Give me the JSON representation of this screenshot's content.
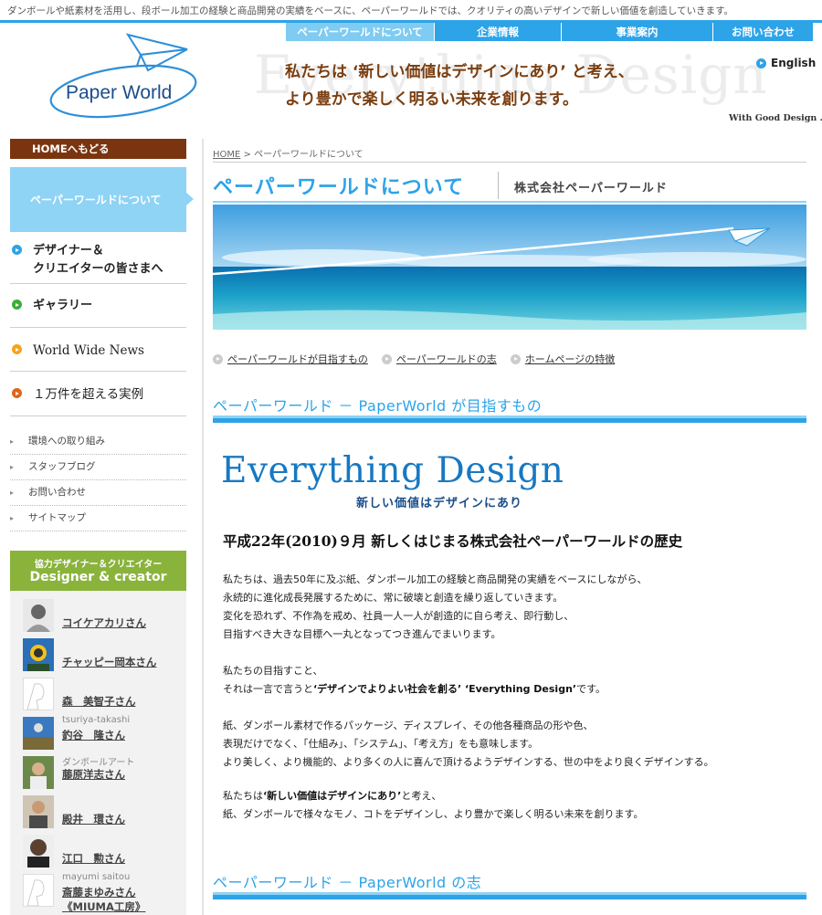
{
  "header": {
    "tagline": "ダンボールや紙素材を活用し、段ボール加工の経験と商品開発の実績をベースに、ペーパーワールドでは、クオリティの高いデザインで新しい価値を創造していきます。",
    "logo_text": "Paper World",
    "nav": [
      {
        "label": "ペーパーワールドについて",
        "active": true
      },
      {
        "label": "企業情報",
        "active": false
      },
      {
        "label": "事業案内",
        "active": false
      },
      {
        "label": "お問い合わせ",
        "active": false
      }
    ],
    "english_label": "English",
    "hero_bg_text": "Everything Design",
    "hero_line1": "私たちは ‘新しい価値はデザインにあり’ と考え、",
    "hero_line2": "より豊かで楽しく明るい未来を創ります。",
    "hero_small": "With Good Design ..."
  },
  "sidebar": {
    "home": "HOMEへもどる",
    "current": "ペーパーワールドについて",
    "items": [
      {
        "label": "デザイナー＆\nクリエイターの皆さまへ",
        "icon": "blue-arrow-icon"
      },
      {
        "label": "ギャラリー",
        "icon": "green-arrow-icon"
      },
      {
        "label": "World Wide News",
        "icon": "orange-arrow-icon"
      },
      {
        "label": "１万件を超える実例",
        "icon": "red-arrow-icon"
      }
    ],
    "sub_items": [
      "環境への取り組み",
      "スタッフブログ",
      "お問い合わせ",
      "サイトマップ"
    ],
    "designer_head_small": "協力デザイナー＆クリエイター",
    "designer_head_big": "Designer & creator",
    "designers": [
      {
        "sub": "",
        "name": "コイケアカリさん"
      },
      {
        "sub": "",
        "name": "チャッピー岡本さん"
      },
      {
        "sub": "",
        "name": "森　美智子さん"
      },
      {
        "sub": "tsuriya-takashi",
        "name": "釣谷　隆さん"
      },
      {
        "sub": "ダンボールアート",
        "name": "藤原洋志さん"
      },
      {
        "sub": "",
        "name": "殿井　環さん"
      },
      {
        "sub": "",
        "name": "江口　勲さん"
      },
      {
        "sub": "mayumi saitou",
        "name": "斎藤まゆみさん",
        "name2": "《MIUMA工房》"
      }
    ]
  },
  "main": {
    "breadcrumb_home": "HOME",
    "breadcrumb_rest": " > ペーパーワールドについて",
    "title": "ペーパーワールドについて",
    "company": "株式会社ペーパーワールド",
    "anchors": [
      "ペーパーワールドが目指すもの",
      "ペーパーワールドの志",
      "ホームページの特徴"
    ],
    "section1_title": "ペーパーワールド － PaperWorld が目指すもの",
    "ed_title": "Everything Design",
    "ed_sub": "新しい価値はデザインにあり",
    "history": "平成22年(2010)９月  新しくはじまる株式会社ペーパーワールドの歴史",
    "p1": [
      "私たちは、過去50年に及ぶ紙、ダンボール加工の経験と商品開発の実績をベースにしながら、",
      "永続的に進化成長発展するために、常に破壊と創造を繰り返していきます。",
      "変化を恐れず、不作為を戒め、社員一人一人が創造的に自ら考え、即行動し、",
      "目指すべき大きな目標へ一丸となってつき進んでまいります。"
    ],
    "p2_line1": "私たちの目指すこと、",
    "p2_line2_pre": "それは一言で言うと",
    "p2_line2_bold": "‘デザインでよりよい社会を創る’ ‘Everything Design’",
    "p2_line2_post": "です。",
    "p3": [
      "紙、ダンボール素材で作るパッケージ、ディスプレイ、その他各種商品の形や色、",
      "表現だけでなく、「仕組み」、「システム」、「考え方」をも意味します。",
      "より美しく、より機能的、より多くの人に喜んで頂けるようデザインする、世の中をより良くデザインする。"
    ],
    "p4_line1_pre": "私たちは",
    "p4_line1_bold": "‘新しい価値はデザインにあり’",
    "p4_line1_post": "と考え、",
    "p4_line2": "紙、ダンボールで様々なモノ、コトをデザインし、より豊かで楽しく明るい未来を創ります。",
    "section2_title": "ペーパーワールド － PaperWorld の志"
  }
}
